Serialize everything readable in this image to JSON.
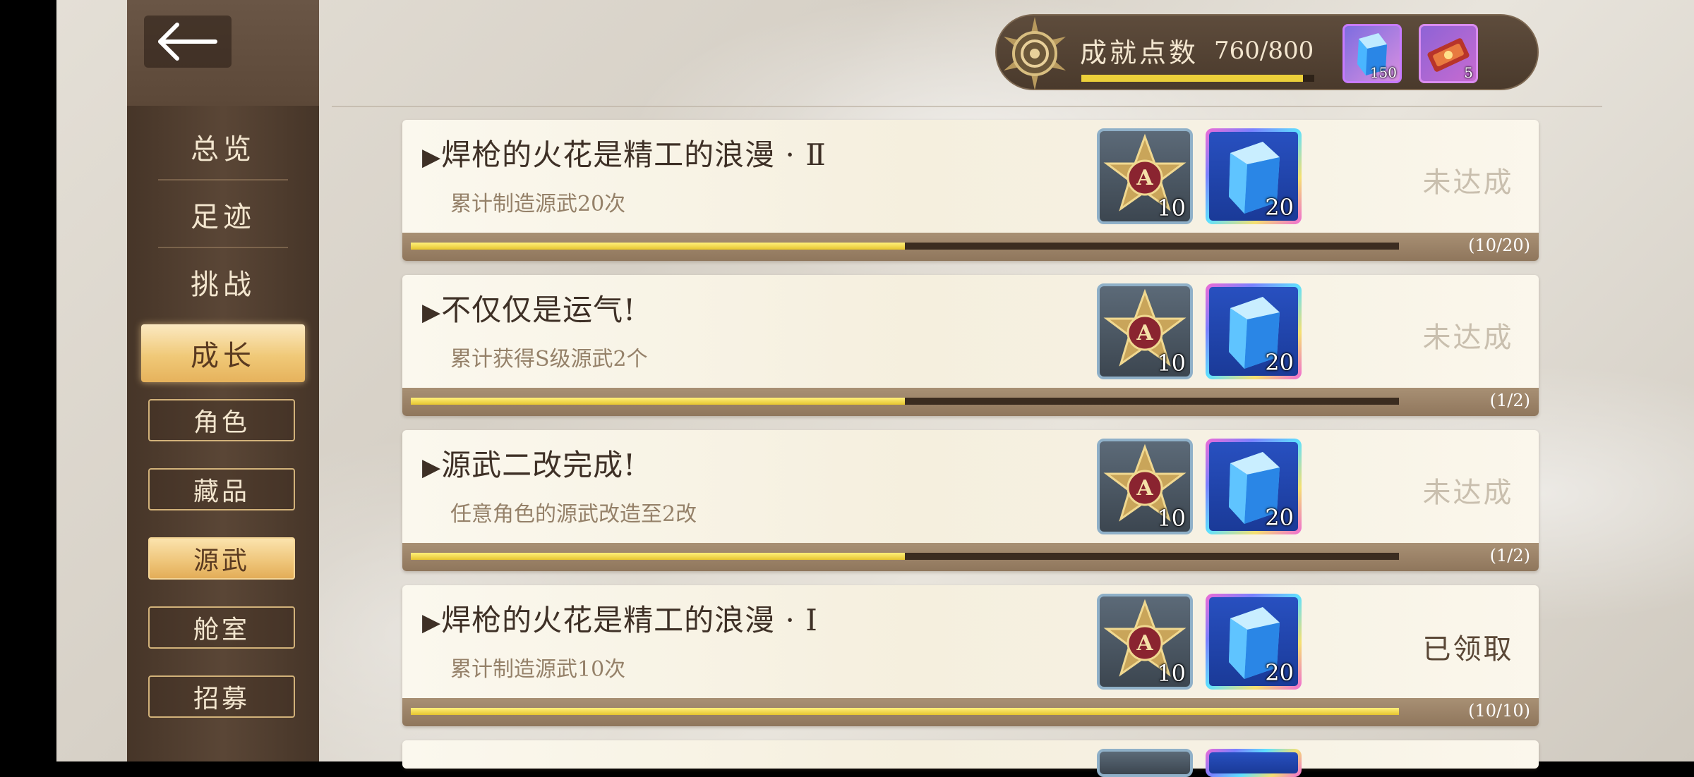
{
  "sidebar": {
    "main_items": [
      {
        "label": "总览"
      },
      {
        "label": "足迹"
      },
      {
        "label": "挑战"
      },
      {
        "label": "成长",
        "active": true
      }
    ],
    "sub_items": [
      {
        "label": "角色"
      },
      {
        "label": "藏品"
      },
      {
        "label": "源武",
        "active": true
      },
      {
        "label": "舱室"
      },
      {
        "label": "招募"
      }
    ]
  },
  "header": {
    "points_label": "成就点数",
    "points_value": "760/800",
    "points_progress": 0.95,
    "items": [
      {
        "icon": "blue-crystal-icon",
        "count": "150"
      },
      {
        "icon": "red-ticket-icon",
        "count": "5"
      }
    ]
  },
  "achievements": [
    {
      "title": "焊枪的火花是精工的浪漫 · Ⅱ",
      "desc": "累计制造源武20次",
      "rewards": [
        "10",
        "20"
      ],
      "status": "未达成",
      "progress": 0.5,
      "progress_text": "(10/20)"
    },
    {
      "title": "不仅仅是运气!",
      "desc": "累计获得S级源武2个",
      "rewards": [
        "10",
        "20"
      ],
      "status": "未达成",
      "progress": 0.5,
      "progress_text": "(1/2)"
    },
    {
      "title": "源武二改完成!",
      "desc": "任意角色的源武改造至2改",
      "rewards": [
        "10",
        "20"
      ],
      "status": "未达成",
      "progress": 0.5,
      "progress_text": "(1/2)"
    },
    {
      "title": "焊枪的火花是精工的浪漫 · Ⅰ",
      "desc": "累计制造源武10次",
      "rewards": [
        "10",
        "20"
      ],
      "status": "已领取",
      "progress": 1.0,
      "progress_text": "(10/10)"
    }
  ],
  "colors": {
    "accent_gold": "#ecd03a",
    "sidebar_bg": "#5a4636",
    "card_bg": "#f8f3e6"
  }
}
